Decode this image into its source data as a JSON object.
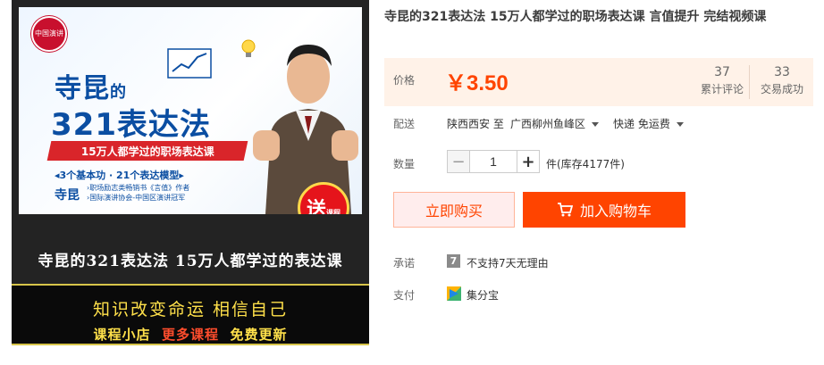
{
  "product": {
    "title": "寺昆的321表达法 15万人都学过的职场表达课 言值提升 完结视频课"
  },
  "image": {
    "logo_text": "中国演讲",
    "title_line1_main": "寺昆",
    "title_line1_small": "的",
    "title_line2": "321表达法",
    "ribbon": "15万人都学过的职场表达课",
    "subtitle": "◂3个基本功 · 21个表达模型▸",
    "author": "寺昆",
    "author_desc_1": "›职场励志类畅销书《言值》作者",
    "author_desc_2": "›国际演讲协会-中国区演讲冠军",
    "gift_big": "送",
    "gift_small": "课程",
    "caption": "寺昆的321表达法 15万人都学过的表达课",
    "promo_line1": "知识改变命运  相信自己",
    "promo_line2_a": "课程小店",
    "promo_line2_b": "更多课程",
    "promo_line2_c": "免费更新"
  },
  "price": {
    "label": "价格",
    "value": "￥3.50",
    "stats": [
      {
        "num": "37",
        "label": "累计评论"
      },
      {
        "num": "33",
        "label": "交易成功"
      }
    ]
  },
  "shipping": {
    "label": "配送",
    "from": "陕西西安 至",
    "to": "广西柳州鱼峰区",
    "method": "快递 免运费"
  },
  "quantity": {
    "label": "数量",
    "minus": "−",
    "value": "1",
    "plus": "+",
    "stock": "件(库存4177件)"
  },
  "actions": {
    "buy_now": "立即购买",
    "add_to_cart": "加入购物车"
  },
  "promise": {
    "label": "承诺",
    "icon": "7",
    "text": "不支持7天无理由"
  },
  "payment": {
    "label": "支付",
    "text": "集分宝"
  },
  "colors": {
    "accent": "#ff4400",
    "price_bg": "#fff2e8",
    "buy_bg": "#ffeded"
  }
}
